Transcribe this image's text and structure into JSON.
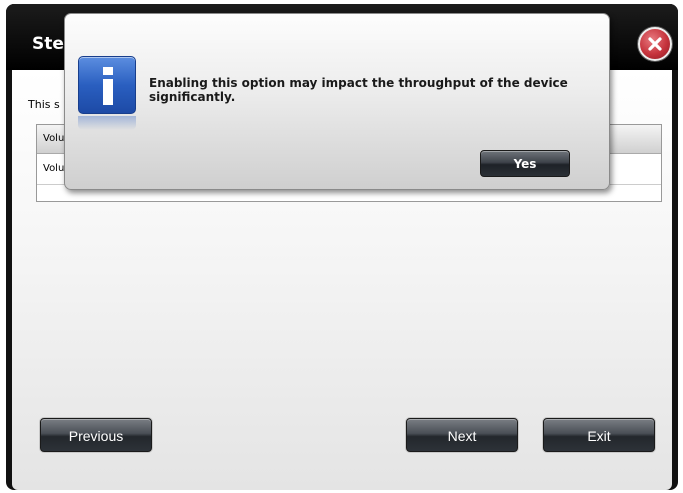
{
  "wizard": {
    "title": "Ste",
    "description": "This s",
    "table": {
      "header": "Volu",
      "row": "Volu"
    },
    "buttons": {
      "previous": "Previous",
      "next": "Next",
      "exit": "Exit"
    },
    "close_icon": "close-x-icon"
  },
  "dialog": {
    "icon": "info-icon",
    "message": "Enabling this option may impact the throughput of the device significantly.",
    "yes_label": "Yes"
  },
  "colors": {
    "header_bg": "#000000",
    "close_red": "#c6343d",
    "info_blue": "#2a5fc0",
    "button_dark": "#2d3238"
  }
}
